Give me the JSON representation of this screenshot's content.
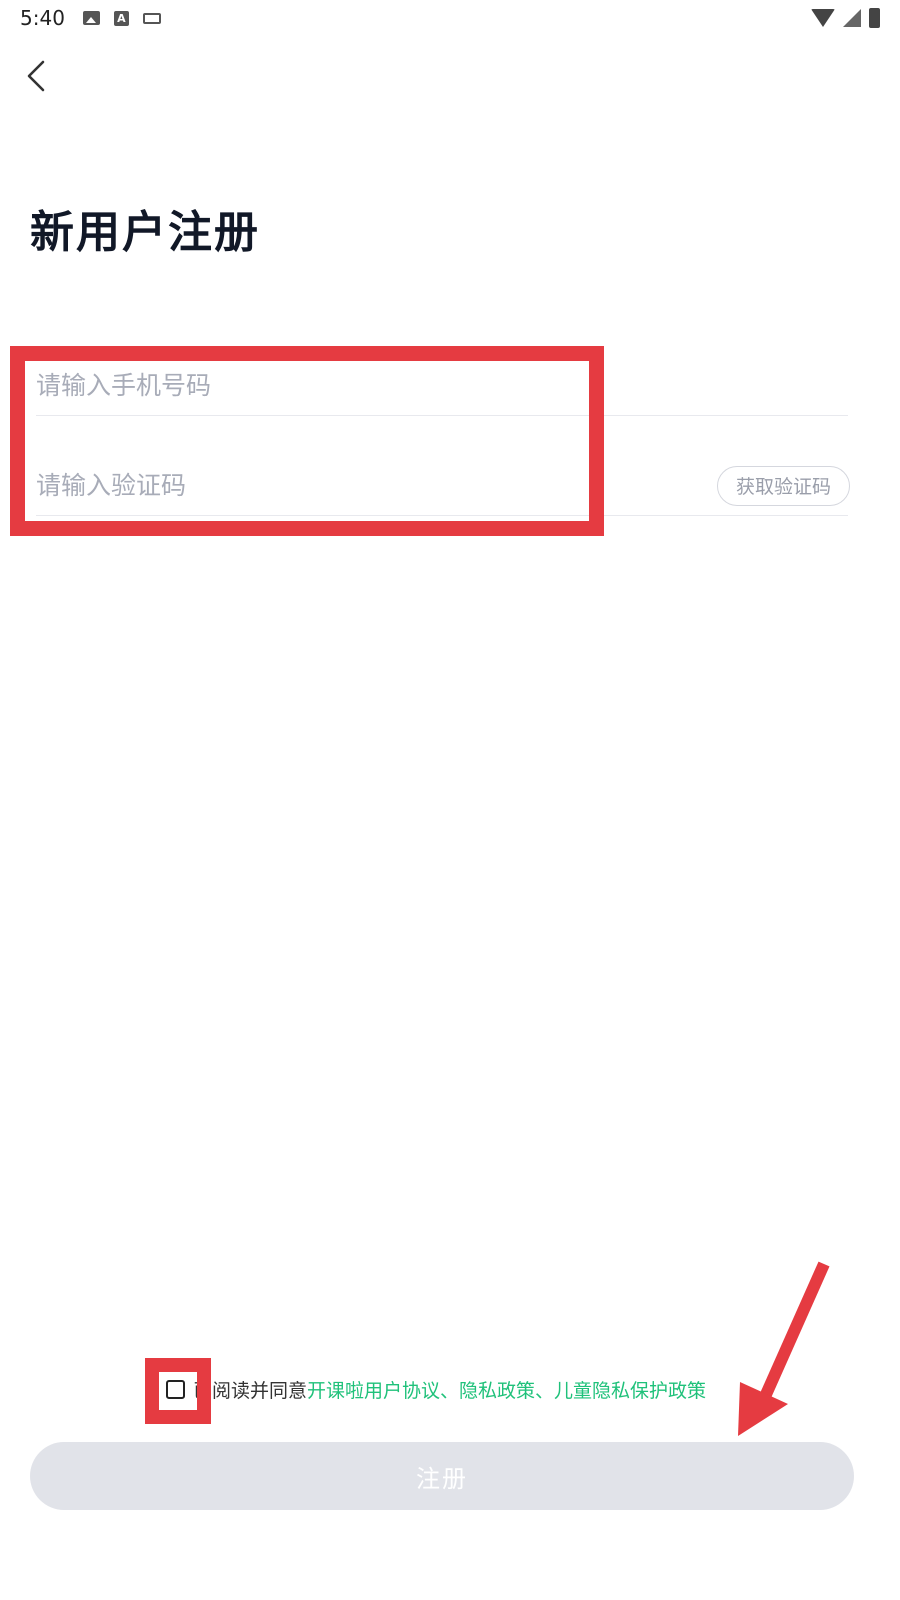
{
  "status_bar": {
    "time": "5:40",
    "icons_left": [
      "photo-icon",
      "a-notification-icon",
      "keyboard-icon"
    ],
    "icons_right": [
      "wifi-icon",
      "signal-icon",
      "battery-icon"
    ]
  },
  "header": {
    "back_icon": "chevron-left-icon"
  },
  "title": "新用户注册",
  "form": {
    "phone_placeholder": "请输入手机号码",
    "code_placeholder": "请输入验证码",
    "get_code_label": "获取验证码"
  },
  "agreement": {
    "prefix": "已阅读并同意",
    "links_text": "开课啦用户协议、隐私政策、儿童隐私保护政策",
    "checked": false
  },
  "register_label": "注册",
  "colors": {
    "accent_green": "#1fc17a",
    "highlight_red": "#e53b41",
    "button_disabled": "#e1e3e9"
  }
}
